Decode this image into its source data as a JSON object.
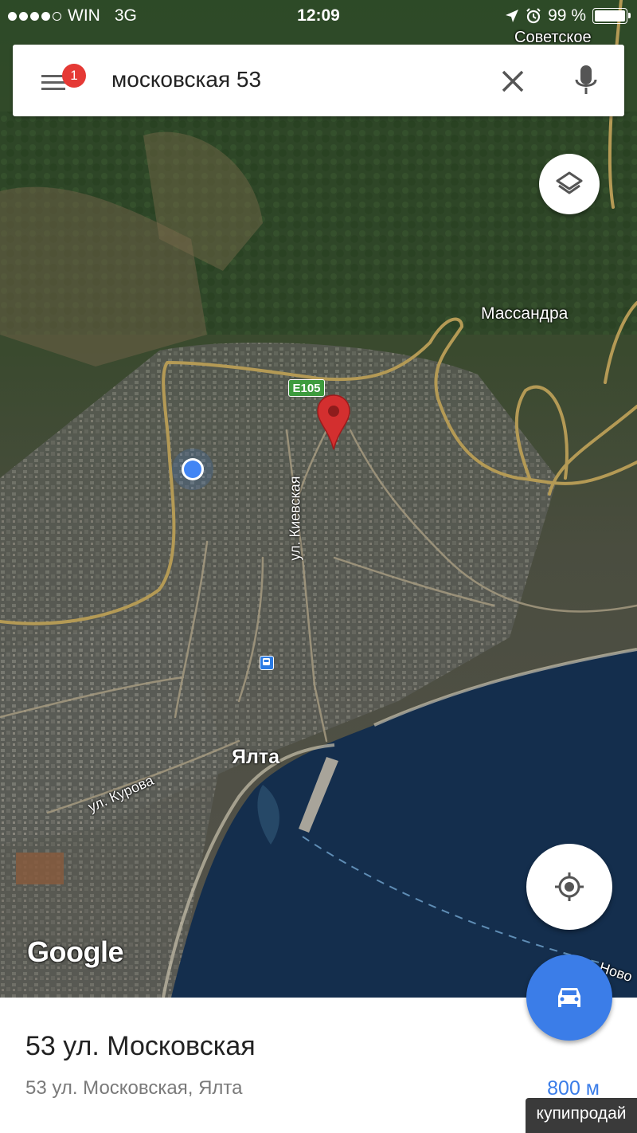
{
  "status_bar": {
    "carrier": "WIN",
    "network": "3G",
    "time": "12:09",
    "battery_text": "99 %",
    "battery_level": 0.99,
    "signal_bars_filled": 4,
    "signal_bars_total": 5
  },
  "search": {
    "query": "московская 53",
    "notification_count": "1"
  },
  "map": {
    "labels": {
      "sovetskoe": "Советское",
      "massandra": "Массандра",
      "yalta": "Ялта",
      "kievskaya": "ул. Киевская",
      "kurova": "ул. Курова",
      "novo": "Ново"
    },
    "road_shield": "E105",
    "attribution": "Google"
  },
  "place": {
    "title": "53 ул. Московская",
    "subtitle": "53 ул. Московская, Ялта",
    "distance": "800 м"
  },
  "watermark": "купипродай",
  "colors": {
    "accent": "#3b7de8",
    "pin": "#d32f2f",
    "badge": "#e53935",
    "sea": "#142e4d",
    "road": "#b49a55"
  },
  "icons": {
    "menu": "menu-icon",
    "clear": "close-icon",
    "mic": "microphone-icon",
    "layers": "layers-icon",
    "locate": "crosshair-icon",
    "drive": "car-icon",
    "pin": "map-pin-icon",
    "location": "blue-dot-icon"
  }
}
